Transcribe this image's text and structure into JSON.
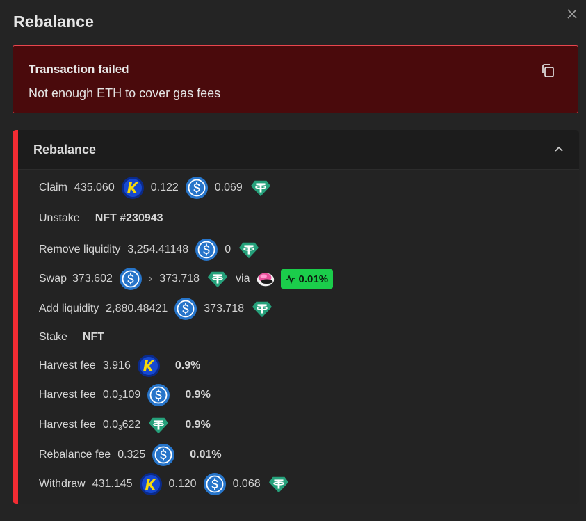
{
  "dialog": {
    "title": "Rebalance"
  },
  "error": {
    "title": "Transaction failed",
    "message": "Not enough ETH to cover gas fees"
  },
  "panel": {
    "title": "Rebalance"
  },
  "steps": {
    "claim": {
      "label": "Claim",
      "v1": "435.060",
      "v2": "0.122",
      "v3": "0.069"
    },
    "unstake": {
      "label": "Unstake",
      "nft": "NFT #230943"
    },
    "remove": {
      "label": "Remove liquidity",
      "v1": "3,254.41148",
      "v2": "0"
    },
    "swap": {
      "label": "Swap",
      "from": "373.602",
      "arrow": "›",
      "to": "373.718",
      "via": "via",
      "fee": "0.01%"
    },
    "add": {
      "label": "Add liquidity",
      "v1": "2,880.48421",
      "v2": "373.718"
    },
    "stake": {
      "label": "Stake",
      "nft": "NFT"
    },
    "harvest1": {
      "label": "Harvest fee",
      "value": "3.916",
      "pct": "0.9%"
    },
    "harvest2": {
      "label": "Harvest fee",
      "value_pre": "0.0",
      "value_sub": "2",
      "value_post": "109",
      "pct": "0.9%"
    },
    "harvest3": {
      "label": "Harvest fee",
      "value_pre": "0.0",
      "value_sub": "3",
      "value_post": "622",
      "pct": "0.9%"
    },
    "rebalance_fee": {
      "label": "Rebalance fee",
      "value": "0.325",
      "pct": "0.01%"
    },
    "withdraw": {
      "label": "Withdraw",
      "v1": "431.145",
      "v2": "0.120",
      "v3": "0.068"
    }
  },
  "tokens": {
    "kyber": "kyber-token-icon",
    "usdc": "usdc-token-icon",
    "usdt": "usdt-token-icon",
    "dex": "dex-logo-icon"
  },
  "colors": {
    "background": "#242424",
    "error_bg": "#4a0a0c",
    "error_border": "#e8464e",
    "accent": "#f12c33",
    "fee_badge": "#1bcd4b",
    "usdc": "#2775ca",
    "usdt": "#26a17b"
  }
}
